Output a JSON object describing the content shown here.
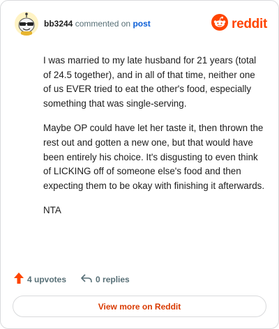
{
  "header": {
    "username": "bb3244",
    "action_text": "commented on",
    "link_text": "post",
    "brand": "reddit"
  },
  "comment": {
    "paragraphs": [
      "I was married to my late husband for 21 years (total of 24.5 together), and in all of that time, neither one of us EVER tried to eat the other's food, especially something that was single-serving.",
      "Maybe OP could have let her taste it, then thrown the rest out and gotten a new one, but that would have been entirely his choice. It's disgusting to even think of LICKING off of someone else's food and then expecting them to be okay with finishing it afterwards.",
      "NTA"
    ]
  },
  "actions": {
    "upvotes_label": "4 upvotes",
    "replies_label": "0 replies"
  },
  "footer": {
    "view_more_label": "View more on Reddit"
  },
  "colors": {
    "brand": "#ff4500",
    "link": "#0b5ed7",
    "cta": "#d93a00",
    "muted": "#576f76"
  },
  "icons": {
    "avatar": "snoo-avatar-icon",
    "logo": "reddit-logo-icon",
    "upvote": "upvote-arrow-icon",
    "reply": "reply-arrow-icon"
  }
}
